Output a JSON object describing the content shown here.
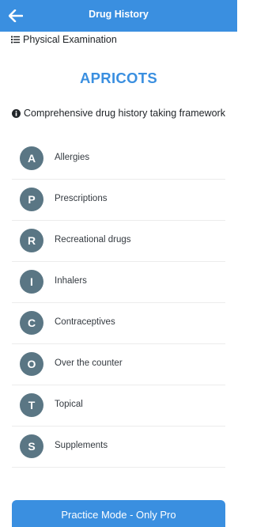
{
  "header": {
    "title": "Drug History",
    "back_icon": "arrow-left-icon"
  },
  "breadcrumb": {
    "label": "Physical Examination",
    "icon": "list-icon"
  },
  "page_title": "APRICOTS",
  "info": {
    "text": "Comprehensive drug history taking framework",
    "icon": "info-circle-icon"
  },
  "items": [
    {
      "letter": "A",
      "label": "Allergies"
    },
    {
      "letter": "P",
      "label": "Prescriptions"
    },
    {
      "letter": "R",
      "label": "Recreational drugs"
    },
    {
      "letter": "I",
      "label": "Inhalers"
    },
    {
      "letter": "C",
      "label": "Contraceptives"
    },
    {
      "letter": "O",
      "label": "Over the counter"
    },
    {
      "letter": "T",
      "label": "Topical"
    },
    {
      "letter": "S",
      "label": "Supplements"
    }
  ],
  "practice_button": {
    "label": "Practice Mode - Only Pro"
  },
  "colors": {
    "primary": "#3a8fe0",
    "circle": "#5a7684"
  }
}
